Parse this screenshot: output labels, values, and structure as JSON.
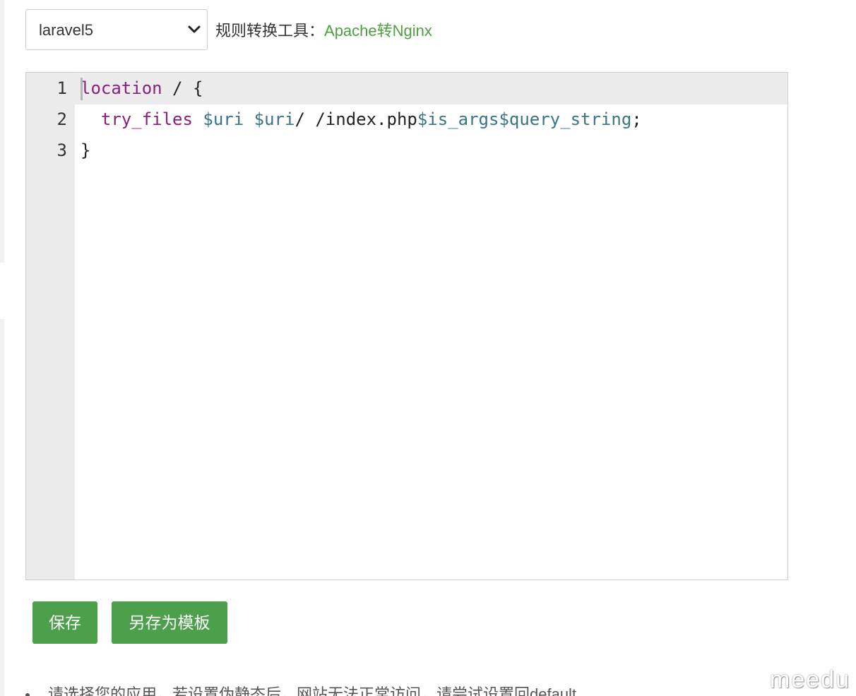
{
  "rule_select": {
    "selected": "laravel5"
  },
  "converter": {
    "label": "规则转换工具：",
    "link_text": "Apache转Nginx"
  },
  "editor": {
    "lines": [
      {
        "number": "1",
        "tokens": [
          {
            "text": "location",
            "type": "keyword"
          },
          {
            "text": " / {",
            "type": "plain"
          }
        ]
      },
      {
        "number": "2",
        "tokens": [
          {
            "text": "  ",
            "type": "plain"
          },
          {
            "text": "try_files",
            "type": "keyword"
          },
          {
            "text": " ",
            "type": "plain"
          },
          {
            "text": "$uri",
            "type": "variable"
          },
          {
            "text": " ",
            "type": "plain"
          },
          {
            "text": "$uri",
            "type": "variable"
          },
          {
            "text": "/ /index.php",
            "type": "plain"
          },
          {
            "text": "$is_args$query_string",
            "type": "variable"
          },
          {
            "text": ";",
            "type": "plain"
          }
        ]
      },
      {
        "number": "3",
        "tokens": [
          {
            "text": "}",
            "type": "plain"
          }
        ]
      }
    ]
  },
  "buttons": {
    "save": "保存",
    "save_template": "另存为模板"
  },
  "tips": {
    "first": "请选择您的应用，若设置伪静态后，网站无法正常访问，请尝试设置回default"
  },
  "watermark": "meedu",
  "colors": {
    "accent_green": "#4da04b",
    "link_green": "#4e9f40",
    "keyword": "#8b1f7e",
    "variable": "#3a7486"
  }
}
